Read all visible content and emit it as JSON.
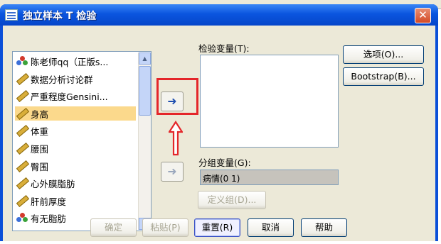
{
  "window": {
    "title": "独立样本 T 检验",
    "close_label": "✕"
  },
  "variables": [
    {
      "label": "陈老师qq（正版s...",
      "type": "nominal"
    },
    {
      "label": "数据分析讨论群",
      "type": "scale"
    },
    {
      "label": "严重程度Gensini...",
      "type": "scale"
    },
    {
      "label": "身高",
      "type": "scale",
      "selected": true
    },
    {
      "label": "体重",
      "type": "scale"
    },
    {
      "label": "腰围",
      "type": "scale"
    },
    {
      "label": "臀围",
      "type": "scale"
    },
    {
      "label": "心外膜脂肪",
      "type": "scale"
    },
    {
      "label": "肝前厚度",
      "type": "scale"
    },
    {
      "label": "有无脂肪",
      "type": "nominal"
    }
  ],
  "test_variables": {
    "label": "检验变量(T):",
    "items": []
  },
  "grouping_variable": {
    "label": "分组变量(G):",
    "value": "病情(0 1)",
    "define_groups_label": "定义组(D)..."
  },
  "side_buttons": {
    "options_label": "选项(O)...",
    "bootstrap_label": "Bootstrap(B)..."
  },
  "footer_buttons": {
    "ok": "确定",
    "paste": "粘贴(P)",
    "reset": "重置(R)",
    "cancel": "取消",
    "help": "帮助"
  },
  "colors": {
    "title_bar": "#0a55df",
    "selection": "#fbd98c",
    "annotation": "#e4262a"
  },
  "icons": {
    "move_arrow": "arrow-right-icon",
    "annotation": "arrow-up-icon"
  }
}
